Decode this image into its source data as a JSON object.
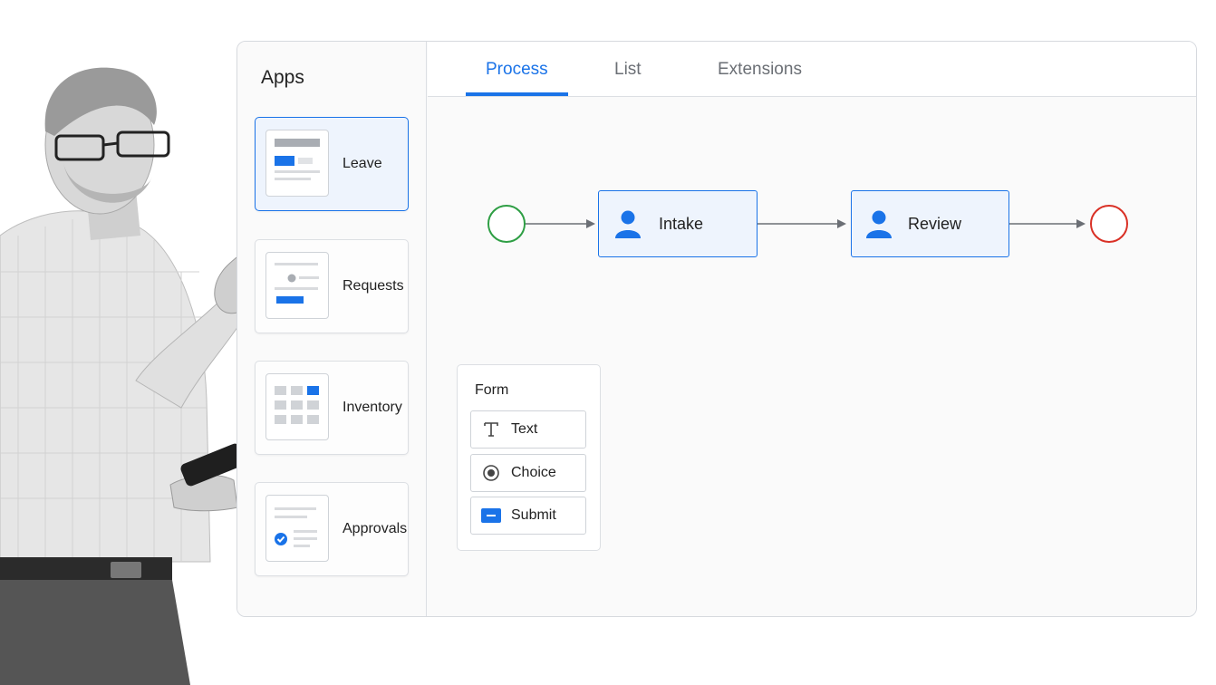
{
  "sidebar": {
    "title": "Apps",
    "apps": [
      {
        "label": "Leave",
        "thumb": "leave-form-thumbnail",
        "selected": true
      },
      {
        "label": "Requests",
        "thumb": "requests-thumbnail",
        "selected": false
      },
      {
        "label": "Inventory",
        "thumb": "inventory-grid-thumbnail",
        "selected": false
      },
      {
        "label": "Approvals",
        "thumb": "approvals-checklist-thumbnail",
        "selected": false
      }
    ]
  },
  "tabs": [
    {
      "label": "Process",
      "active": true
    },
    {
      "label": "List",
      "active": false
    },
    {
      "label": "Extensions",
      "active": false
    }
  ],
  "process": {
    "start_event": "start-circle",
    "tasks": [
      {
        "label": "Intake",
        "icon": "user-icon"
      },
      {
        "label": "Review",
        "icon": "user-icon"
      }
    ],
    "end_event": "end-circle"
  },
  "form": {
    "title": "Form",
    "items": [
      {
        "label": "Text",
        "icon": "text-T-icon"
      },
      {
        "label": "Choice",
        "icon": "radio-icon"
      },
      {
        "label": "Submit",
        "icon": "button-icon"
      }
    ]
  },
  "colors": {
    "accent": "#1a73e8",
    "start": "#2e9e44",
    "end": "#d93025",
    "connector": "#6b6f75"
  }
}
